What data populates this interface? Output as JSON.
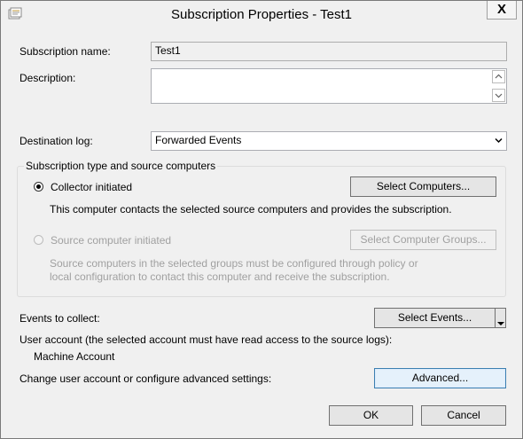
{
  "window": {
    "title": "Subscription Properties - Test1",
    "close_label": "X"
  },
  "subscription_name": {
    "label": "Subscription name:",
    "value": "Test1"
  },
  "description": {
    "label": "Description:",
    "value": ""
  },
  "destination_log": {
    "label": "Destination log:",
    "value": "Forwarded Events"
  },
  "group": {
    "title": "Subscription type and source computers",
    "collector": {
      "label": "Collector initiated",
      "selected": true,
      "description": "This computer contacts the selected source computers and provides the subscription.",
      "button": "Select Computers..."
    },
    "source": {
      "label": "Source computer initiated",
      "selected": false,
      "description_line1": "Source computers in the selected groups must be configured through policy or",
      "description_line2": "local configuration to contact this computer and receive the subscription.",
      "button": "Select Computer Groups..."
    }
  },
  "events": {
    "label": "Events to collect:",
    "button": "Select Events..."
  },
  "user_account": {
    "label": "User account (the selected account must have read access to the source logs):",
    "value": "Machine Account"
  },
  "advanced": {
    "label": "Change user account or configure advanced settings:",
    "button": "Advanced..."
  },
  "footer": {
    "ok": "OK",
    "cancel": "Cancel"
  }
}
